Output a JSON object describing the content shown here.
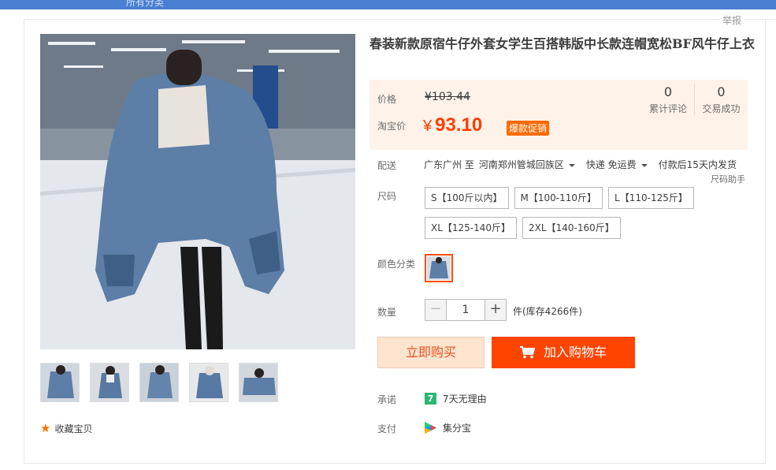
{
  "topbar": {
    "crumb": "所有分类"
  },
  "report_label": "举报",
  "product": {
    "title": "春装新款原宿牛仔外套女学生百搭韩版中长款连帽宽松BF风牛仔上衣",
    "favorite_label": "收藏宝贝",
    "thumbnail_count": 5
  },
  "price": {
    "price_label": "价格",
    "old_price": "¥103.44",
    "taobao_label": "淘宝价",
    "currency": "¥",
    "current_price": "93.10",
    "promo_badge": "爆款促销"
  },
  "stats": {
    "reviews_count": "0",
    "reviews_label": "累计评论",
    "deals_count": "0",
    "deals_label": "交易成功"
  },
  "shipping": {
    "label": "配送",
    "from": "广东广州 至",
    "to": "河南郑州管城回族区",
    "method": "快递 免运费",
    "dispatch": "付款后15天内发货",
    "size_help": "尺码助手"
  },
  "sizes": {
    "label": "尺码",
    "options": [
      "S【100斤以内】",
      "M【100-110斤】",
      "L【110-125斤】",
      "XL【125-140斤】",
      "2XL【140-160斤】"
    ]
  },
  "color": {
    "label": "颜色分类"
  },
  "quantity": {
    "label": "数量",
    "minus": "−",
    "value": "1",
    "plus": "+",
    "stock": "件(库存4266件)"
  },
  "actions": {
    "buy_now": "立即购买",
    "add_to_cart": "加入购物车"
  },
  "promise": {
    "label": "承诺",
    "icon_text": "7",
    "text": "7天无理由"
  },
  "payment": {
    "label": "支付",
    "text": "集分宝"
  },
  "colors": {
    "accent": "#ff4400",
    "price": "#ff3d00",
    "pricebox_bg": "#fff2e8",
    "topbar": "#4a7fd1"
  }
}
